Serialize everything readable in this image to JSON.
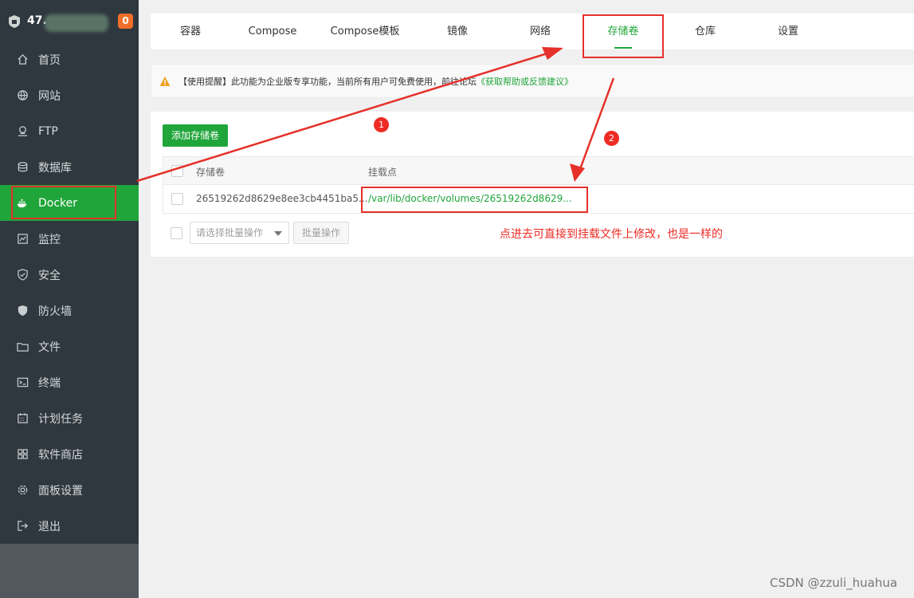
{
  "sidebar": {
    "server_ip": "47.",
    "badge_count": "0",
    "items": [
      {
        "label": "首页",
        "icon": "home-icon"
      },
      {
        "label": "网站",
        "icon": "globe-icon"
      },
      {
        "label": "FTP",
        "icon": "ftp-icon"
      },
      {
        "label": "数据库",
        "icon": "database-icon"
      },
      {
        "label": "Docker",
        "icon": "docker-icon"
      },
      {
        "label": "监控",
        "icon": "monitor-icon"
      },
      {
        "label": "安全",
        "icon": "shield-icon"
      },
      {
        "label": "防火墙",
        "icon": "firewall-icon"
      },
      {
        "label": "文件",
        "icon": "folder-icon"
      },
      {
        "label": "终端",
        "icon": "terminal-icon"
      },
      {
        "label": "计划任务",
        "icon": "calendar-icon"
      },
      {
        "label": "软件商店",
        "icon": "grid-icon"
      },
      {
        "label": "面板设置",
        "icon": "gear-icon"
      },
      {
        "label": "退出",
        "icon": "logout-icon"
      }
    ],
    "active_item": "Docker"
  },
  "tabs": [
    {
      "label": "容器"
    },
    {
      "label": "Compose"
    },
    {
      "label": "Compose模板"
    },
    {
      "label": "镜像"
    },
    {
      "label": "网络"
    },
    {
      "label": "存储卷"
    },
    {
      "label": "仓库"
    },
    {
      "label": "设置"
    }
  ],
  "active_tab": "存储卷",
  "notice": {
    "text": "【使用提醒】此功能为企业版专享功能，当前所有用户可免费使用，前往论坛",
    "link": "《获取帮助或反馈建议》"
  },
  "volumes": {
    "add_button": "添加存储卷",
    "columns": [
      "存储卷",
      "挂载点"
    ],
    "rows": [
      {
        "name": "26519262d8629e8ee3cb4451ba5...",
        "mountpoint": "/var/lib/docker/volumes/26519262d8629..."
      }
    ],
    "batch_select_placeholder": "请选择批量操作",
    "batch_button": "批量操作"
  },
  "annotations": {
    "step1": "1",
    "step2": "2",
    "note": "点进去可直接到挂载文件上修改，也是一样的"
  },
  "watermark": "CSDN @zzuli_huahua",
  "colors": {
    "accent": "#20a53a",
    "sidebar_bg": "#30383f",
    "annotation_red": "#e5312a",
    "badge": "#f06f29"
  }
}
